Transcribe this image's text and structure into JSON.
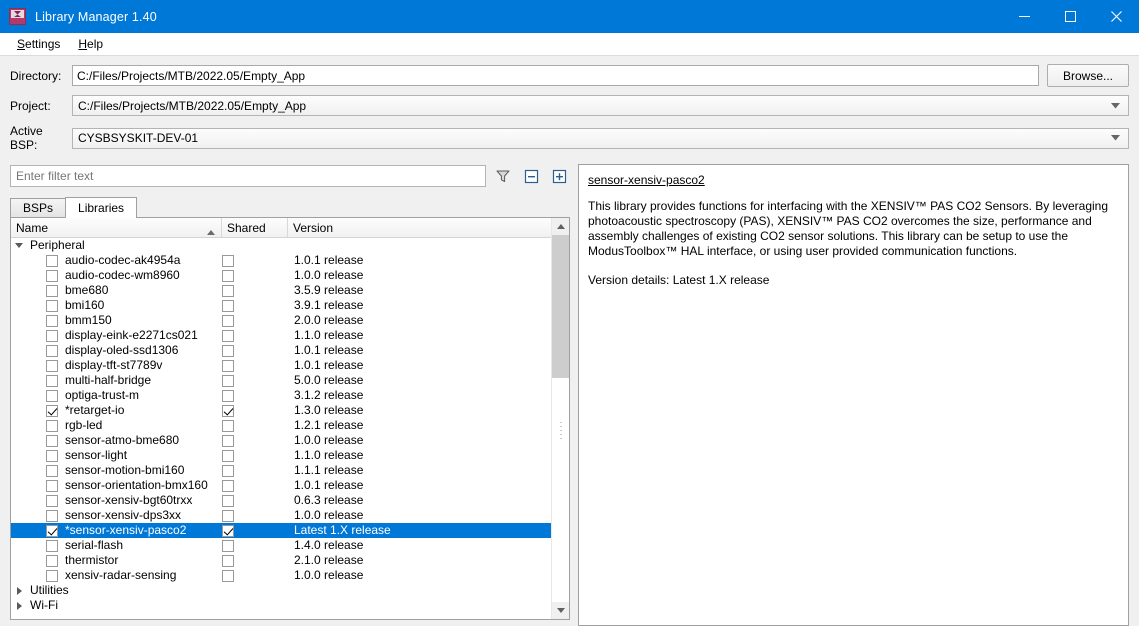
{
  "window": {
    "title": "Library Manager 1.40",
    "app_icon": "library-manager-icon",
    "controls": {
      "minimize": "minimize-icon",
      "maximize": "maximize-icon",
      "close": "close-icon"
    }
  },
  "menubar": {
    "items": [
      {
        "label": "Settings",
        "mnemonic": "S"
      },
      {
        "label": "Help",
        "mnemonic": "H"
      }
    ]
  },
  "form": {
    "directory": {
      "label": "Directory:",
      "value": "C:/Files/Projects/MTB/2022.05/Empty_App"
    },
    "project": {
      "label": "Project:",
      "value": "C:/Files/Projects/MTB/2022.05/Empty_App"
    },
    "active_bsp": {
      "label": "Active BSP:",
      "value": "CYSBSYSKIT-DEV-01"
    },
    "browse_label": "Browse..."
  },
  "filter": {
    "placeholder": "Enter filter text",
    "value": "",
    "icons": {
      "filter": "funnel-icon",
      "collapse_all": "collapse-all-icon",
      "expand_all": "expand-all-icon"
    }
  },
  "tabs": [
    {
      "label": "BSPs",
      "active": false
    },
    {
      "label": "Libraries",
      "active": true
    }
  ],
  "table": {
    "columns": [
      {
        "label": "Name",
        "sort": "ascending"
      },
      {
        "label": "Shared",
        "sort": ""
      },
      {
        "label": "Version",
        "sort": ""
      }
    ],
    "rows": [
      {
        "type": "group",
        "name": "Peripheral",
        "expanded": true
      },
      {
        "type": "item",
        "name": "audio-codec-ak4954a",
        "checked": false,
        "shared": false,
        "version": "1.0.1 release",
        "selected": false
      },
      {
        "type": "item",
        "name": "audio-codec-wm8960",
        "checked": false,
        "shared": false,
        "version": "1.0.0 release",
        "selected": false
      },
      {
        "type": "item",
        "name": "bme680",
        "checked": false,
        "shared": false,
        "version": "3.5.9 release",
        "selected": false
      },
      {
        "type": "item",
        "name": "bmi160",
        "checked": false,
        "shared": false,
        "version": "3.9.1 release",
        "selected": false
      },
      {
        "type": "item",
        "name": "bmm150",
        "checked": false,
        "shared": false,
        "version": "2.0.0 release",
        "selected": false
      },
      {
        "type": "item",
        "name": "display-eink-e2271cs021",
        "checked": false,
        "shared": false,
        "version": "1.1.0 release",
        "selected": false
      },
      {
        "type": "item",
        "name": "display-oled-ssd1306",
        "checked": false,
        "shared": false,
        "version": "1.0.1 release",
        "selected": false
      },
      {
        "type": "item",
        "name": "display-tft-st7789v",
        "checked": false,
        "shared": false,
        "version": "1.0.1 release",
        "selected": false
      },
      {
        "type": "item",
        "name": "multi-half-bridge",
        "checked": false,
        "shared": false,
        "version": "5.0.0 release",
        "selected": false
      },
      {
        "type": "item",
        "name": "optiga-trust-m",
        "checked": false,
        "shared": false,
        "version": "3.1.2 release",
        "selected": false
      },
      {
        "type": "item",
        "name": "*retarget-io",
        "checked": true,
        "shared": true,
        "version": "1.3.0 release",
        "selected": false
      },
      {
        "type": "item",
        "name": "rgb-led",
        "checked": false,
        "shared": false,
        "version": "1.2.1 release",
        "selected": false
      },
      {
        "type": "item",
        "name": "sensor-atmo-bme680",
        "checked": false,
        "shared": false,
        "version": "1.0.0 release",
        "selected": false
      },
      {
        "type": "item",
        "name": "sensor-light",
        "checked": false,
        "shared": false,
        "version": "1.1.0 release",
        "selected": false
      },
      {
        "type": "item",
        "name": "sensor-motion-bmi160",
        "checked": false,
        "shared": false,
        "version": "1.1.1 release",
        "selected": false
      },
      {
        "type": "item",
        "name": "sensor-orientation-bmx160",
        "checked": false,
        "shared": false,
        "version": "1.0.1 release",
        "selected": false
      },
      {
        "type": "item",
        "name": "sensor-xensiv-bgt60trxx",
        "checked": false,
        "shared": false,
        "version": "0.6.3 release",
        "selected": false
      },
      {
        "type": "item",
        "name": "sensor-xensiv-dps3xx",
        "checked": false,
        "shared": false,
        "version": "1.0.0 release",
        "selected": false
      },
      {
        "type": "item",
        "name": "*sensor-xensiv-pasco2",
        "checked": true,
        "shared": true,
        "version": "Latest 1.X release",
        "selected": true
      },
      {
        "type": "item",
        "name": "serial-flash",
        "checked": false,
        "shared": false,
        "version": "1.4.0 release",
        "selected": false
      },
      {
        "type": "item",
        "name": "thermistor",
        "checked": false,
        "shared": false,
        "version": "2.1.0 release",
        "selected": false
      },
      {
        "type": "item",
        "name": "xensiv-radar-sensing",
        "checked": false,
        "shared": false,
        "version": "1.0.0 release",
        "selected": false
      },
      {
        "type": "group",
        "name": "Utilities",
        "expanded": false
      },
      {
        "type": "group",
        "name": "Wi-Fi",
        "expanded": false
      }
    ]
  },
  "details": {
    "title": "sensor-xensiv-pasco2",
    "description": "This library provides functions for interfacing with the XENSIV™ PAS CO2 Sensors. By leveraging photoacoustic spectroscopy (PAS), XENSIV™ PAS CO2 overcomes the size, performance and assembly challenges of existing CO2 sensor solutions. This library can be setup to use the ModusToolbox™ HAL interface, or using user provided communication functions.",
    "version_details": "Version details: Latest 1.X release"
  },
  "colors": {
    "accent": "#0078d7",
    "titlebar": "#0078d7",
    "selection": "#0078d7",
    "window_bg": "#f0f0f0"
  }
}
